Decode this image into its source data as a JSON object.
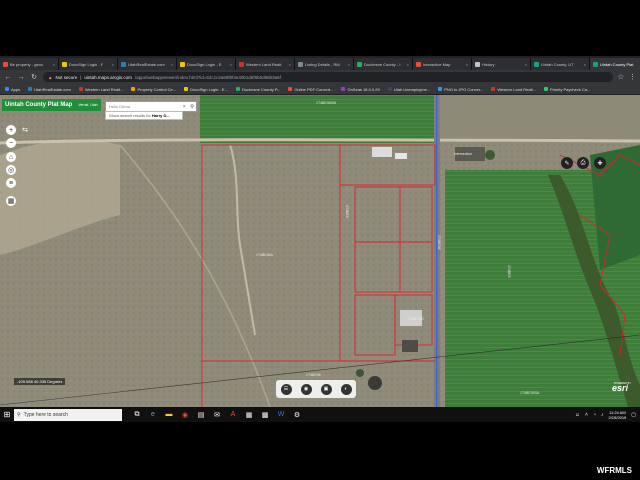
{
  "browser": {
    "tabs": [
      {
        "label": "Be property - geox",
        "color": "#e74c3c"
      },
      {
        "label": "DocuSign Login - F",
        "color": "#f1c40f"
      },
      {
        "label": "UtahRealEstate.com",
        "color": "#2980b9"
      },
      {
        "label": "DocuSign Login - E",
        "color": "#f1c40f"
      },
      {
        "label": "Western Land Realt",
        "color": "#c0392b"
      },
      {
        "label": "Listing Details - RM",
        "color": "#7f8c8d"
      },
      {
        "label": "Duchesne County - I",
        "color": "#27ae60"
      },
      {
        "label": "Interactive Map",
        "color": "#e74c3c"
      },
      {
        "label": "History",
        "color": "#bdc3c7"
      },
      {
        "label": "Uintah County, UT",
        "color": "#16a085"
      },
      {
        "label": "Uintah County Plat",
        "color": "#16a085",
        "active": true
      }
    ],
    "address": {
      "security": "Not secure",
      "host": "uintah.maps.arcgis.com",
      "path": "/apps/webappviewer/index.html?id=52c1c2a69f0f4e40b1d5f8b0d98b3a6f"
    },
    "bookmarks": [
      {
        "label": "Apps",
        "color": "#4285f4"
      },
      {
        "label": "UtahRealEstate.com",
        "color": "#2980b9"
      },
      {
        "label": "Western Land Realt...",
        "color": "#c0392b"
      },
      {
        "label": "Property Control Ce...",
        "color": "#f39c12"
      },
      {
        "label": "DocuSign Login - E...",
        "color": "#f1c40f"
      },
      {
        "label": "Duchesne County P...",
        "color": "#27ae60"
      },
      {
        "label": "Online PDF Convert...",
        "color": "#e74c3c"
      },
      {
        "label": "OnSeas 18.0.0.29",
        "color": "#8e44ad"
      },
      {
        "label": "Utah Unemployme...",
        "color": "#34495e"
      },
      {
        "label": "PNG to JPG Conver...",
        "color": "#3498db"
      },
      {
        "label": "Western Land Realt...",
        "color": "#c0392b"
      },
      {
        "label": "Priority Paycheck Ca...",
        "color": "#2ecc71"
      }
    ]
  },
  "app": {
    "title": "Uintah County Plat Map",
    "location": "Vernal, Utah",
    "search_value": "Hello Debra",
    "suggestion_prefix": "Show search results for",
    "suggestion_bold": "Harry D..."
  },
  "map": {
    "coordinates": "-109.588 40.335 Degrees",
    "esri_label": "esri",
    "esri_sublabel": "POWERED BY",
    "labels": {
      "l1": "1T4BE06SW",
      "l2": "Intersection",
      "l3": "1T4BE5",
      "l4": "1T4BE06A",
      "l5": "1T4BE06",
      "l6": "1T4BE5",
      "l7": "1T4BE08",
      "l8": "1T4BE05SA",
      "l9": "1T4BE08C"
    }
  },
  "taskbar": {
    "search_placeholder": "Type here to search",
    "time": "11:24 AM",
    "date": "2/15/2019"
  },
  "watermark": "WFRMLS"
}
